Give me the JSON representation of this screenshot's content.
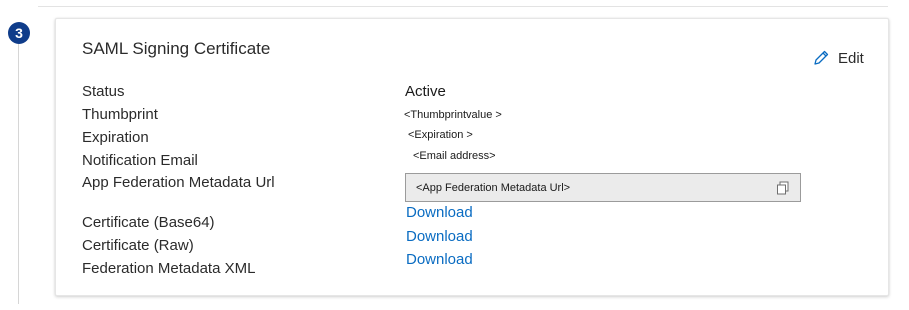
{
  "step": {
    "number": "3"
  },
  "card": {
    "title": "SAML Signing Certificate",
    "edit_label": "Edit"
  },
  "fields": {
    "status": {
      "label": "Status",
      "value": "Active"
    },
    "thumbprint": {
      "label": "Thumbprint",
      "value": "<Thumbprintvalue >"
    },
    "expiration": {
      "label": "Expiration",
      "value": "<Expiration >"
    },
    "notification_email": {
      "label": "Notification Email",
      "value": "<Email address>"
    },
    "metadata_url": {
      "label": "App Federation Metadata Url",
      "value": "<App Federation  Metadata Url>"
    },
    "cert_base64": {
      "label": "Certificate (Base64)",
      "link": "Download"
    },
    "cert_raw": {
      "label": "Certificate (Raw)",
      "link": "Download"
    },
    "federation_xml": {
      "label": "Federation Metadata XML",
      "link": "Download"
    }
  },
  "icons": {
    "edit": "pencil-icon",
    "copy": "copy-icon"
  },
  "colors": {
    "step_badge": "#0f3c8a",
    "link": "#0a6cc2",
    "url_box_bg": "#ebebeb"
  }
}
